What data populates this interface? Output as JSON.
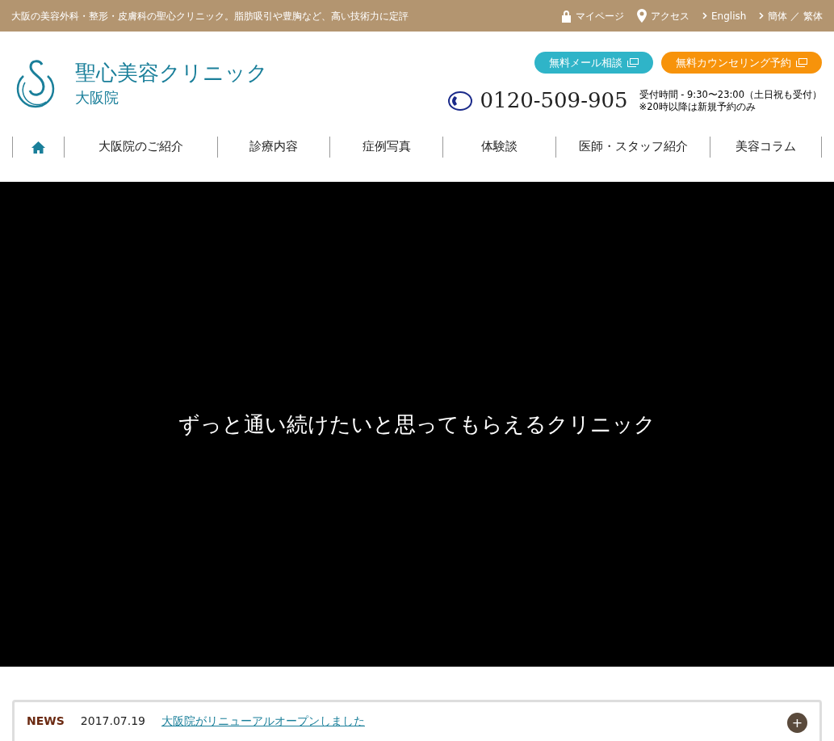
{
  "top_bar": {
    "tagline": "大阪の美容外科・整形・皮膚科の聖心クリニック。脂肪吸引や豊胸など、高い技術力に定評",
    "links": [
      {
        "kind": "lock",
        "label": "マイページ"
      },
      {
        "kind": "pin",
        "label": "アクセス"
      },
      {
        "kind": "chevron",
        "label": "English"
      },
      {
        "kind": "chevron",
        "label": "簡体 ／ 繁体"
      }
    ]
  },
  "header": {
    "clinic_name": "聖心美容クリニック",
    "branch": "大阪院",
    "buttons": [
      {
        "label": "無料メール相談",
        "color": "#2fb4c8"
      },
      {
        "label": "無料カウンセリング予約",
        "color": "#f7930b"
      }
    ],
    "phone": "0120-509-905",
    "hours": "受付時間 - 9:30〜23:00（土日祝も受付）",
    "note": "※20時以降は新規予約のみ"
  },
  "nav": [
    {
      "kind": "home"
    },
    {
      "kind": "text",
      "label": "大阪院のご紹介"
    },
    {
      "kind": "text",
      "label": "診療内容"
    },
    {
      "kind": "text",
      "label": "症例写真"
    },
    {
      "kind": "text",
      "label": "体験談"
    },
    {
      "kind": "text",
      "label": "医師・スタッフ紹介"
    },
    {
      "kind": "text",
      "label": "美容コラム"
    }
  ],
  "hero": {
    "headline": "ずっと通い続けたいと思ってもらえるクリニック"
  },
  "news": {
    "label": "NEWS",
    "date": "2017.07.19",
    "title": "大阪院がリニューアルオープンしました",
    "expand": "+"
  }
}
